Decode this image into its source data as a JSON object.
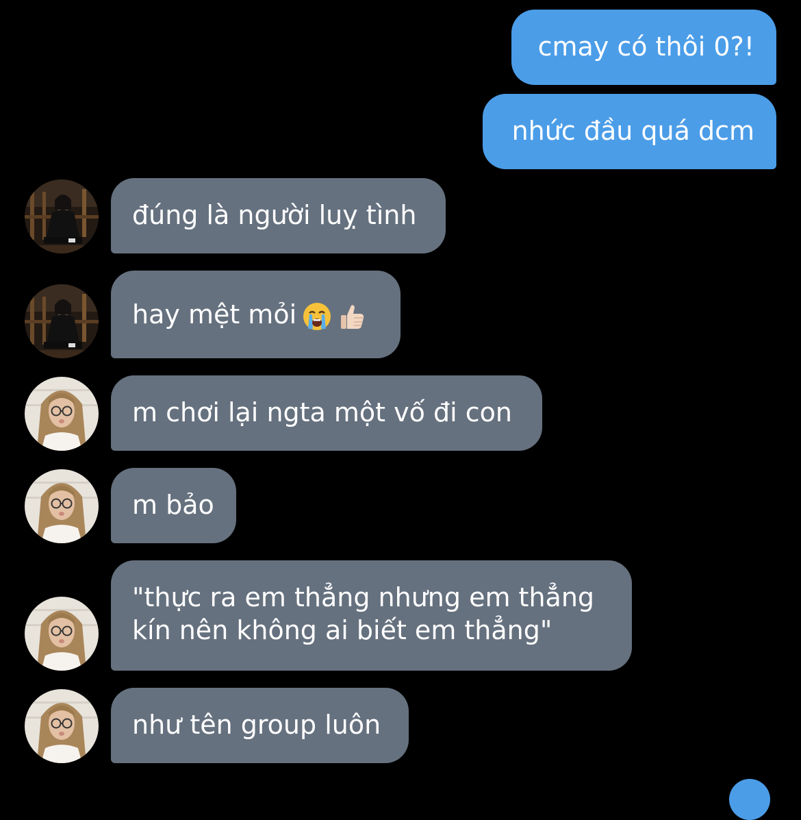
{
  "conversation": {
    "sent_messages": [
      {
        "text": "cmay có thôi 0?!"
      },
      {
        "text": "nhức đầu quá dcm"
      }
    ],
    "received_messages": [
      {
        "sender": "contact-a",
        "text": "đúng là người luỵ tình"
      },
      {
        "sender": "contact-a",
        "text": "hay mệt mỏi",
        "emojis": [
          "loudly-crying-face-emoji",
          "thumbs-up-emoji"
        ]
      },
      {
        "sender": "contact-b",
        "text": "m chơi lại ngta một vố đi con"
      },
      {
        "sender": "contact-b",
        "text": "m bảo"
      },
      {
        "sender": "contact-b",
        "line1": "\"thực ra em thẳng nhưng em thẳng",
        "line2": "kín nên không ai biết em thẳng\""
      },
      {
        "sender": "contact-b",
        "text": "như tên group luôn"
      }
    ]
  },
  "colors": {
    "background": "#000000",
    "sent_bubble": "#4b9de8",
    "received_bubble": "#66717f",
    "text": "#ffffff"
  }
}
